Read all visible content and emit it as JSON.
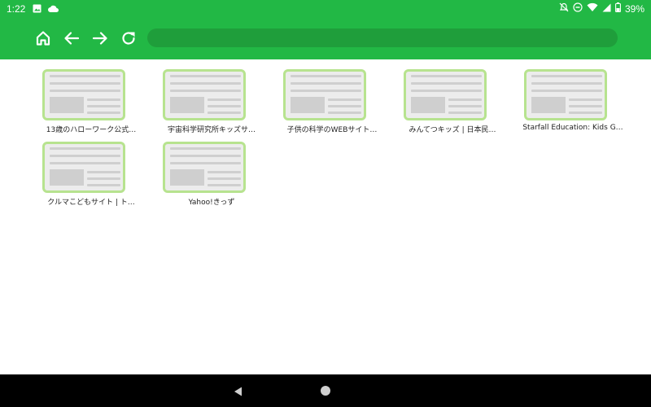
{
  "status": {
    "time": "1:22",
    "battery": "39%",
    "left_icons": [
      "image-icon",
      "cloud-icon"
    ],
    "right_icons": [
      "mute-icon",
      "dnd-icon",
      "wifi-icon",
      "signal-icon",
      "battery-icon"
    ]
  },
  "toolbar": {
    "icons": [
      "home-icon",
      "back-arrow-icon",
      "forward-arrow-icon",
      "reload-icon"
    ],
    "address_value": ""
  },
  "bookmarks": [
    {
      "title": "13歳のハローワーク公式…"
    },
    {
      "title": "宇宙科学研究所キッズサ…"
    },
    {
      "title": "子供の科学のWEBサイト…"
    },
    {
      "title": "みんてつキッズ | 日本民…"
    },
    {
      "title": "Starfall Education: Kids G…"
    },
    {
      "title": "クルマこどもサイト | ト…"
    },
    {
      "title": "Yahoo!きっず"
    }
  ],
  "colors": {
    "brand_green": "#22b845",
    "address_bar": "#1f9e3b",
    "thumb_border": "#b7e38f",
    "nav_bar": "#000000"
  }
}
